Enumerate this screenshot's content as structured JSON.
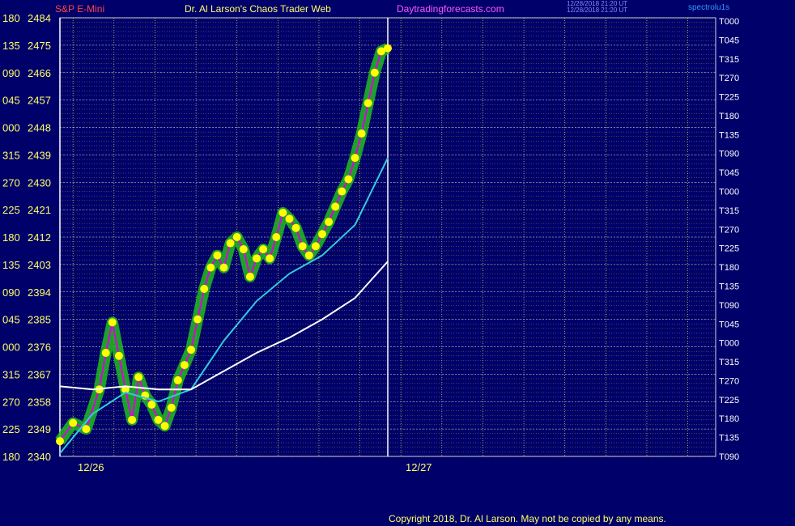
{
  "header": {
    "symbol": "S&P E-Mini",
    "title": "Dr. Al Larson's Chaos Trader Web",
    "site": "Daytradingforecasts.com",
    "timestamp_line1": "12/28/2018 21:20 UT",
    "timestamp_line2": "12/28/2018 21:20 UT",
    "right_tag": "spectrolu1s"
  },
  "copyright": "Copyright 2018, Dr. Al Larson. May not be copied by any means.",
  "colors": {
    "background": "#00006b",
    "grid_minor": "#b0b020",
    "grid_major": "#d8d8d8",
    "price_band": "#22bb22",
    "price_dots": "#ffff00",
    "fast_avg": "#33ccdd",
    "slow_avg": "#ffffff",
    "magenta": "#dd00dd"
  },
  "chart_data": {
    "type": "line",
    "title": "S&P E-Mini",
    "xlabel": "",
    "ylabel": "",
    "ylim": [
      2340,
      2484
    ],
    "y_ticks": [
      2484,
      2475,
      2466,
      2457,
      2448,
      2439,
      2430,
      2421,
      2412,
      2403,
      2394,
      2385,
      2376,
      2367,
      2358,
      2349,
      2340
    ],
    "y_angles": [
      "180",
      "135",
      "090",
      "045",
      "000",
      "315",
      "270",
      "225",
      "180",
      "135",
      "090",
      "045",
      "000",
      "315",
      "270",
      "225",
      "180"
    ],
    "x_labels": [
      {
        "label": "12/26",
        "x": 0
      },
      {
        "label": "12/27",
        "x": 100
      }
    ],
    "x_range": [
      0,
      200
    ],
    "series": [
      {
        "values_xy": [
          [
            0,
            2345
          ],
          [
            4,
            2351
          ],
          [
            8,
            2349
          ],
          [
            12,
            2362
          ],
          [
            14,
            2374
          ],
          [
            16,
            2384
          ],
          [
            18,
            2373
          ],
          [
            20,
            2362
          ],
          [
            22,
            2352
          ],
          [
            24,
            2366
          ],
          [
            26,
            2360
          ],
          [
            28,
            2357
          ],
          [
            30,
            2352
          ],
          [
            32,
            2350
          ],
          [
            34,
            2356
          ],
          [
            36,
            2365
          ],
          [
            38,
            2370
          ],
          [
            40,
            2375
          ],
          [
            42,
            2385
          ],
          [
            44,
            2395
          ],
          [
            46,
            2402
          ],
          [
            48,
            2406
          ],
          [
            50,
            2402
          ],
          [
            52,
            2410
          ],
          [
            54,
            2412
          ],
          [
            56,
            2408
          ],
          [
            58,
            2399
          ],
          [
            60,
            2405
          ],
          [
            62,
            2408
          ],
          [
            64,
            2405
          ],
          [
            66,
            2412
          ],
          [
            68,
            2420
          ],
          [
            70,
            2418
          ],
          [
            72,
            2415
          ],
          [
            74,
            2409
          ],
          [
            76,
            2406
          ],
          [
            78,
            2409
          ],
          [
            80,
            2413
          ],
          [
            82,
            2417
          ],
          [
            84,
            2422
          ],
          [
            86,
            2427
          ],
          [
            88,
            2431
          ],
          [
            90,
            2438
          ],
          [
            92,
            2446
          ],
          [
            94,
            2456
          ],
          [
            96,
            2466
          ],
          [
            98,
            2473
          ],
          [
            100,
            2474
          ]
        ]
      },
      {
        "values_xy": [
          [
            0,
            2341
          ],
          [
            10,
            2354
          ],
          [
            20,
            2361
          ],
          [
            30,
            2358
          ],
          [
            40,
            2362
          ],
          [
            50,
            2378
          ],
          [
            60,
            2391
          ],
          [
            70,
            2400
          ],
          [
            80,
            2406
          ],
          [
            90,
            2416
          ],
          [
            100,
            2438
          ]
        ]
      },
      {
        "values_xy": [
          [
            0,
            2363
          ],
          [
            10,
            2362
          ],
          [
            20,
            2363
          ],
          [
            30,
            2362
          ],
          [
            40,
            2362
          ],
          [
            50,
            2368
          ],
          [
            60,
            2374
          ],
          [
            70,
            2379
          ],
          [
            80,
            2385
          ],
          [
            90,
            2392
          ],
          [
            100,
            2404
          ]
        ]
      }
    ],
    "right_labels": [
      "T000",
      "T045",
      "T315",
      "T270",
      "T225",
      "T180",
      "T135",
      "T090",
      "T045",
      "T000",
      "T315",
      "T270",
      "T225",
      "T180",
      "T135",
      "T090",
      "T045",
      "T000",
      "T315",
      "T270",
      "T225",
      "T180",
      "T135",
      "T090"
    ],
    "grid": true,
    "legend": "none"
  }
}
